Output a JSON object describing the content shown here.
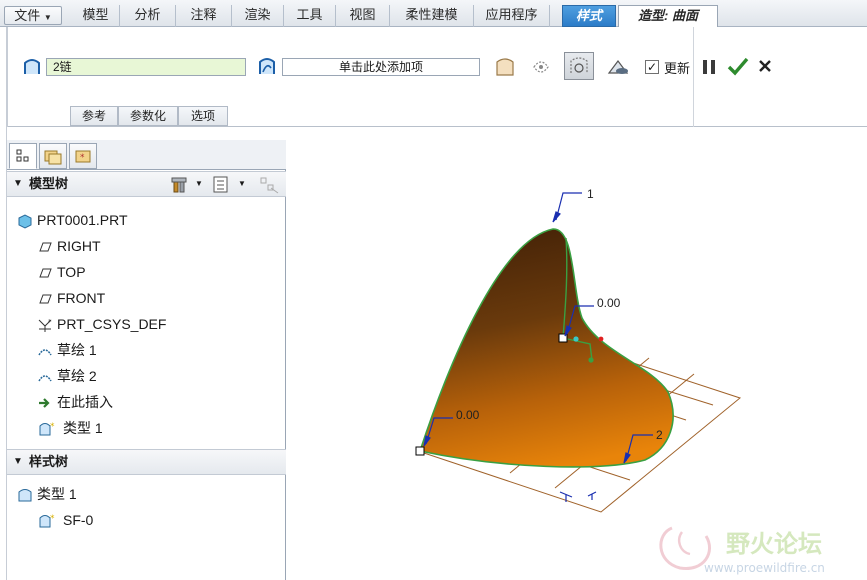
{
  "menu": {
    "file": "文件",
    "tabs": [
      "模型",
      "分析",
      "注释",
      "渲染",
      "工具",
      "视图",
      "柔性建模",
      "应用程序"
    ],
    "style_tab": "样式",
    "active_tab": "造型: 曲面"
  },
  "ribbon": {
    "primary_value": "2链",
    "secondary_placeholder": "单击此处添加项",
    "update_label": "更新",
    "update_checked": true,
    "subtabs": [
      "参考",
      "参数化",
      "选项"
    ]
  },
  "model_tree": {
    "title": "模型树",
    "items": [
      {
        "label": "PRT0001.PRT",
        "icon": "part-icon"
      },
      {
        "label": "RIGHT",
        "icon": "datum-plane-icon"
      },
      {
        "label": "TOP",
        "icon": "datum-plane-icon"
      },
      {
        "label": "FRONT",
        "icon": "datum-plane-icon"
      },
      {
        "label": "PRT_CSYS_DEF",
        "icon": "csys-icon"
      },
      {
        "label": "草绘 1",
        "icon": "sketch-icon"
      },
      {
        "label": "草绘 2",
        "icon": "sketch-icon"
      },
      {
        "label": "在此插入",
        "icon": "insert-here-arrow-icon"
      },
      {
        "label": "类型 1",
        "icon": "style-feature-icon"
      }
    ]
  },
  "style_tree": {
    "title": "样式树",
    "items": [
      {
        "label": "类型 1",
        "icon": "style-feature-icon"
      },
      {
        "label": "SF-0",
        "icon": "style-surface-icon"
      }
    ]
  },
  "graphics": {
    "label_1": "1",
    "label_2": "2",
    "dim_top": "0.00",
    "dim_left": "0.00",
    "watermark_brand": "野火论坛",
    "watermark_url": "www.proewildfire.cn"
  },
  "colors": {
    "accent_blue": "#2c7cc8",
    "surface_edge": "#3aa042",
    "surface_dark": "#4a2608",
    "surface_light": "#e8840a",
    "grid": "#a0622a",
    "annotation_blue": "#1a2fb0",
    "confirm_green": "#2e8b2e"
  }
}
